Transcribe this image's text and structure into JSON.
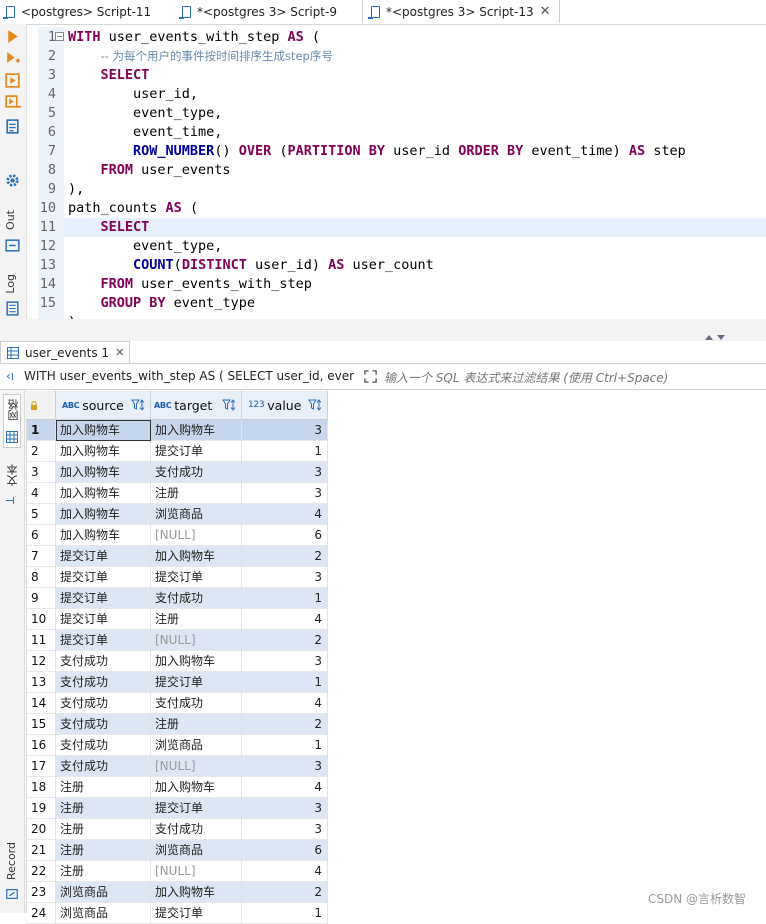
{
  "tabs": [
    {
      "label": "<postgres> Script-11",
      "active": false
    },
    {
      "label": "*<postgres 3> Script-9",
      "active": false
    },
    {
      "label": "*<postgres 3> Script-13",
      "active": true,
      "close": "✕"
    }
  ],
  "editor": {
    "line_numbers": [
      "1",
      "2",
      "3",
      "4",
      "5",
      "6",
      "7",
      "8",
      "9",
      "10",
      "11",
      "12",
      "13",
      "14",
      "15"
    ],
    "lines": [
      [
        {
          "t": "kw",
          "v": "WITH"
        },
        {
          "t": "",
          "v": " user_events_with_step "
        },
        {
          "t": "kw",
          "v": "AS"
        },
        {
          "t": "",
          "v": " ("
        }
      ],
      [
        {
          "t": "",
          "v": "    "
        },
        {
          "t": "cm",
          "v": "-- 为每个用户的事件按时间排序生成step序号"
        }
      ],
      [
        {
          "t": "",
          "v": "    "
        },
        {
          "t": "kw",
          "v": "SELECT"
        }
      ],
      [
        {
          "t": "",
          "v": "        user_id,"
        }
      ],
      [
        {
          "t": "",
          "v": "        event_type,"
        }
      ],
      [
        {
          "t": "",
          "v": "        event_time,"
        }
      ],
      [
        {
          "t": "",
          "v": "        "
        },
        {
          "t": "fn",
          "v": "ROW_NUMBER"
        },
        {
          "t": "",
          "v": "() "
        },
        {
          "t": "kw",
          "v": "OVER"
        },
        {
          "t": "",
          "v": " ("
        },
        {
          "t": "kw",
          "v": "PARTITION BY"
        },
        {
          "t": "",
          "v": " user_id "
        },
        {
          "t": "kw",
          "v": "ORDER BY"
        },
        {
          "t": "",
          "v": " event_time) "
        },
        {
          "t": "kw",
          "v": "AS"
        },
        {
          "t": "",
          "v": " step"
        }
      ],
      [
        {
          "t": "",
          "v": "    "
        },
        {
          "t": "kw",
          "v": "FROM"
        },
        {
          "t": "",
          "v": " user_events"
        }
      ],
      [
        {
          "t": "",
          "v": "),"
        }
      ],
      [
        {
          "t": "",
          "v": "path_counts "
        },
        {
          "t": "kw",
          "v": "AS"
        },
        {
          "t": "",
          "v": " ("
        }
      ],
      [
        {
          "t": "",
          "v": "    "
        },
        {
          "t": "kw",
          "v": "SELECT"
        }
      ],
      [
        {
          "t": "",
          "v": "        event_type,"
        }
      ],
      [
        {
          "t": "",
          "v": "        "
        },
        {
          "t": "fn",
          "v": "COUNT"
        },
        {
          "t": "",
          "v": "("
        },
        {
          "t": "kw",
          "v": "DISTINCT"
        },
        {
          "t": "",
          "v": " user_id) "
        },
        {
          "t": "kw",
          "v": "AS"
        },
        {
          "t": "",
          "v": " user_count"
        }
      ],
      [
        {
          "t": "",
          "v": "    "
        },
        {
          "t": "kw",
          "v": "FROM"
        },
        {
          "t": "",
          "v": " user_events_with_step"
        }
      ],
      [
        {
          "t": "",
          "v": "    "
        },
        {
          "t": "kw",
          "v": "GROUP BY"
        },
        {
          "t": "",
          "v": " event_type"
        }
      ]
    ]
  },
  "results": {
    "tab_label": "user_events 1",
    "tab_close": "✕",
    "filter_query": "WITH user_events_with_step AS ( SELECT user_id, event_t",
    "filter_placeholder": "输入一个 SQL 表达式来过滤结果 (使用 Ctrl+Space)",
    "side_tabs": {
      "grid": "网格",
      "text": "文本"
    },
    "left_labels": {
      "out": "Out",
      "log": "Log",
      "record": "Record"
    },
    "columns": [
      {
        "name": "source",
        "type": "ABC"
      },
      {
        "name": "target",
        "type": "ABC"
      },
      {
        "name": "value",
        "type": "123"
      }
    ],
    "rows": [
      [
        "1",
        "加入购物车",
        "加入购物车",
        "3"
      ],
      [
        "2",
        "加入购物车",
        "提交订单",
        "1"
      ],
      [
        "3",
        "加入购物车",
        "支付成功",
        "3"
      ],
      [
        "4",
        "加入购物车",
        "注册",
        "3"
      ],
      [
        "5",
        "加入购物车",
        "浏览商品",
        "4"
      ],
      [
        "6",
        "加入购物车",
        "[NULL]",
        "6"
      ],
      [
        "7",
        "提交订单",
        "加入购物车",
        "2"
      ],
      [
        "8",
        "提交订单",
        "提交订单",
        "3"
      ],
      [
        "9",
        "提交订单",
        "支付成功",
        "1"
      ],
      [
        "10",
        "提交订单",
        "注册",
        "4"
      ],
      [
        "11",
        "提交订单",
        "[NULL]",
        "2"
      ],
      [
        "12",
        "支付成功",
        "加入购物车",
        "3"
      ],
      [
        "13",
        "支付成功",
        "提交订单",
        "1"
      ],
      [
        "14",
        "支付成功",
        "支付成功",
        "4"
      ],
      [
        "15",
        "支付成功",
        "注册",
        "2"
      ],
      [
        "16",
        "支付成功",
        "浏览商品",
        "1"
      ],
      [
        "17",
        "支付成功",
        "[NULL]",
        "3"
      ],
      [
        "18",
        "注册",
        "加入购物车",
        "4"
      ],
      [
        "19",
        "注册",
        "提交订单",
        "3"
      ],
      [
        "20",
        "注册",
        "支付成功",
        "3"
      ],
      [
        "21",
        "注册",
        "浏览商品",
        "6"
      ],
      [
        "22",
        "注册",
        "[NULL]",
        "4"
      ],
      [
        "23",
        "浏览商品",
        "加入购物车",
        "2"
      ],
      [
        "24",
        "浏览商品",
        "提交订单",
        "1"
      ]
    ]
  },
  "watermark": "CSDN @言析数智",
  "colors": {
    "keyword": "#7f0055",
    "function": "#0000a0",
    "accent": "#1a5fb4",
    "row_alt": "#dde6f2"
  }
}
